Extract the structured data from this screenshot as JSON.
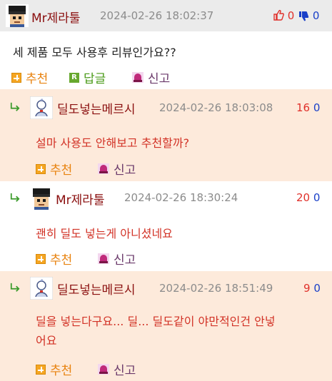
{
  "main_comment": {
    "author": "Mr제라툴",
    "time": "2024-02-26 18:02:37",
    "up": "0",
    "down": "0",
    "text": "세 제품 모두 사용후 리뷰인가요??",
    "actions": {
      "recommend": "추천",
      "reply": "답글",
      "report": "신고"
    },
    "reply_icon_letter": "R"
  },
  "replies": [
    {
      "author": "딜도넣는메르시",
      "time": "2024-02-26 18:03:08",
      "up": "16",
      "down": "0",
      "text": "설마 사용도 안해보고 추천할까?",
      "recommend": "추천",
      "report": "신고"
    },
    {
      "author": "Mr제라툴",
      "time": "2024-02-26 18:30:24",
      "up": "20",
      "down": "0",
      "text": "괜히 딜도 넣는게 아니셨네요",
      "recommend": "추천",
      "report": "신고"
    },
    {
      "author": "딜도넣는메르시",
      "time": "2024-02-26 18:51:49",
      "up": "9",
      "down": "0",
      "text_line1": "딜을 넣는다구요... 딜... 딜도같이 야만적인건 안넣",
      "text_line2": "어요",
      "recommend": "추천",
      "report": "신고"
    }
  ],
  "colors": {
    "username": "#8a0e0e",
    "reply_bg": "#fdeadb",
    "reply_text": "#d23226",
    "upvote": "#e0302a",
    "downvote": "#1a40c8"
  }
}
